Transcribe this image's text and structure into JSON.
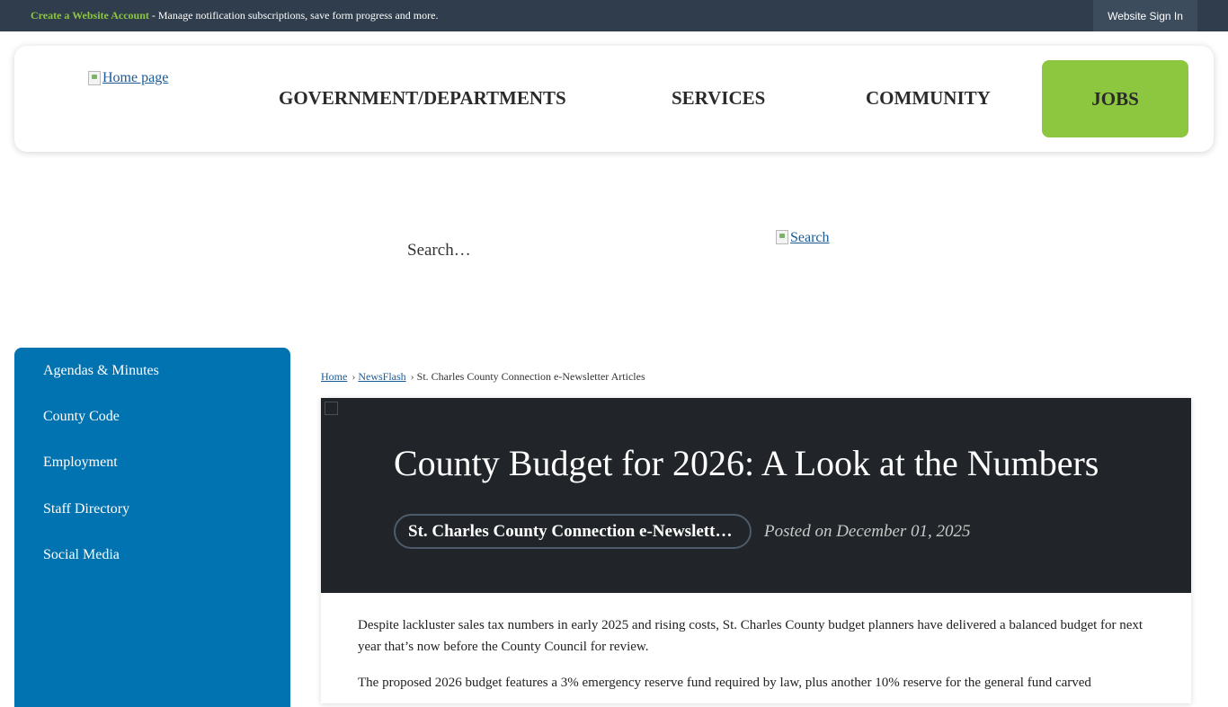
{
  "topbar": {
    "create_account": "Create a Website Account",
    "message": " - Manage notification subscriptions, save form progress and more.",
    "sign_in": "Website Sign In"
  },
  "header": {
    "logo_alt": "Home page",
    "nav": {
      "government": "GOVERNMENT/DEPARTMENTS",
      "services": "SERVICES",
      "community": "COMMUNITY",
      "jobs": "JOBS"
    }
  },
  "search": {
    "placeholder": "Search…",
    "button_alt": "Search"
  },
  "sidebar": {
    "items": [
      {
        "label": "Agendas & Minutes"
      },
      {
        "label": "County Code"
      },
      {
        "label": "Employment"
      },
      {
        "label": "Staff Directory"
      },
      {
        "label": "Social Media"
      }
    ]
  },
  "breadcrumb": {
    "home": "Home",
    "newsflash": "NewsFlash",
    "current": "St. Charles County Connection e-Newsletter Articles"
  },
  "article": {
    "title": "County Budget for 2026: A Look at the Numbers",
    "category": "St. Charles County Connection e-Newsletter Articles",
    "posted": "Posted on December 01, 2025",
    "paragraphs": [
      "Despite lackluster sales tax numbers in early 2025 and rising costs, St. Charles County budget planners have delivered a balanced budget for next year that’s now before the County Council for review.",
      "The proposed 2026 budget features a 3% emergency reserve fund required by law, plus another 10% reserve for the general fund carved"
    ]
  },
  "colors": {
    "topbar_bg": "#2f3d4c",
    "accent_green": "#8dc63f",
    "sidebar_blue": "#0073b0",
    "hero_dark": "#212529",
    "link_blue": "#1a5a96"
  }
}
